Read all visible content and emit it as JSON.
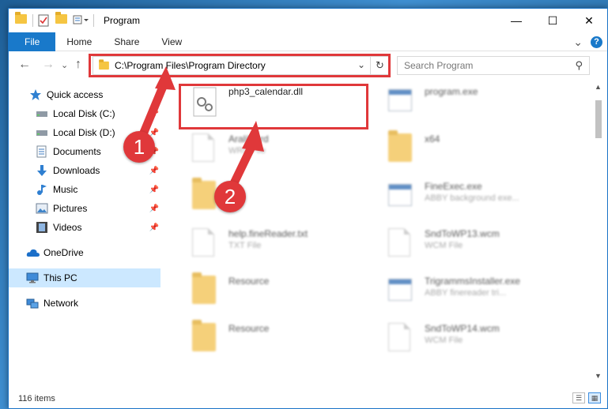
{
  "titlebar": {
    "title": "Program",
    "minimize_glyph": "—",
    "maximize_glyph": "☐",
    "close_glyph": "✕"
  },
  "ribbon": {
    "tabs": [
      {
        "label": "File"
      },
      {
        "label": "Home"
      },
      {
        "label": "Share"
      },
      {
        "label": "View"
      }
    ],
    "expand_glyph": "⌄",
    "help_glyph": "?"
  },
  "navbar": {
    "back_glyph": "←",
    "forward_glyph": "→",
    "recent_glyph": "⌄",
    "up_glyph": "↑",
    "address": "C:\\Program Files\\Program Directory",
    "address_chevron": "⌄",
    "refresh_glyph": "↻",
    "search_placeholder": "Search Program",
    "search_glyph": "⚲"
  },
  "sidebar": {
    "items": [
      {
        "label": "Quick access",
        "icon": "star-icon",
        "pinned": false
      },
      {
        "label": "Local Disk (C:)",
        "icon": "drive-icon",
        "pinned": true
      },
      {
        "label": "Local Disk (D:)",
        "icon": "drive-icon",
        "pinned": true
      },
      {
        "label": "Documents",
        "icon": "documents-icon",
        "pinned": true
      },
      {
        "label": "Downloads",
        "icon": "download-icon",
        "pinned": true
      },
      {
        "label": "Music",
        "icon": "music-icon",
        "pinned": true
      },
      {
        "label": "Pictures",
        "icon": "pictures-icon",
        "pinned": true
      },
      {
        "label": "Videos",
        "icon": "videos-icon",
        "pinned": true
      },
      {
        "label": "OneDrive",
        "icon": "cloud-icon",
        "pinned": false
      },
      {
        "label": "This PC",
        "icon": "computer-icon",
        "pinned": false,
        "selected": true
      },
      {
        "label": "Network",
        "icon": "network-icon",
        "pinned": false
      }
    ],
    "pin_glyph": "📌"
  },
  "files": [
    {
      "name": "php3_calendar.dll",
      "type": "",
      "icon": "dll-gear-icon"
    },
    {
      "name": "program.exe",
      "type": "",
      "icon": "exe-icon"
    },
    {
      "name": "Aralik...rd",
      "type": "WRD File",
      "icon": "document-icon"
    },
    {
      "name": "x64",
      "type": "",
      "icon": "folder-icon"
    },
    {
      "name": "",
      "type": "",
      "icon": "folder-icon"
    },
    {
      "name": "FineExec.exe",
      "type": "ABBY background exe...",
      "icon": "exe-icon"
    },
    {
      "name": "help.fineReader.txt",
      "type": "TXT File",
      "icon": "document-icon"
    },
    {
      "name": "SndToWP13.wcm",
      "type": "WCM File",
      "icon": "document-icon"
    },
    {
      "name": "Resource",
      "type": "",
      "icon": "folder-icon"
    },
    {
      "name": "TrigrammsInstaller.exe",
      "type": "ABBY finereader tri...",
      "icon": "exe-icon"
    },
    {
      "name": "Resource",
      "type": "",
      "icon": "folder-icon"
    },
    {
      "name": "SndToWP14.wcm",
      "type": "WCM File",
      "icon": "document-icon"
    }
  ],
  "status": {
    "item_count": "116 items"
  },
  "annotations": {
    "step1": "1",
    "step2": "2",
    "color": "#e0383a"
  },
  "colors": {
    "accent": "#1979ca",
    "selection": "#cce8ff"
  }
}
